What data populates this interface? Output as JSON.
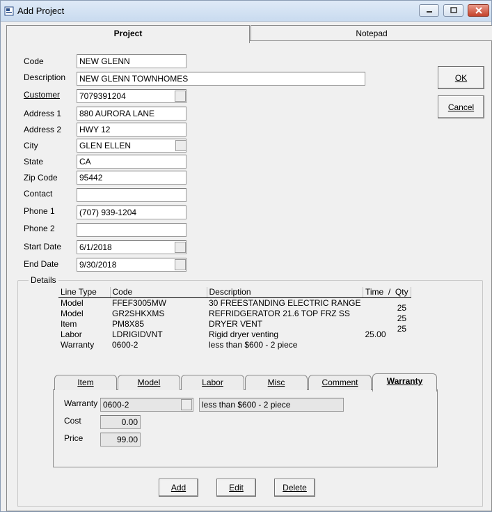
{
  "window": {
    "title": "Add Project"
  },
  "main_tabs": [
    {
      "label": "Project"
    },
    {
      "label": "Notepad"
    }
  ],
  "form": {
    "code": {
      "label": "Code",
      "value": "NEW GLENN"
    },
    "description": {
      "label": "Description",
      "value": "NEW GLENN TOWNHOMES"
    },
    "customer": {
      "label": "Customer",
      "value": "7079391204"
    },
    "address1": {
      "label": "Address 1",
      "value": "880 AURORA LANE"
    },
    "address2": {
      "label": "Address 2",
      "value": "HWY 12"
    },
    "city": {
      "label": "City",
      "value": "GLEN ELLEN"
    },
    "state": {
      "label": "State",
      "value": "CA"
    },
    "zip": {
      "label": "Zip Code",
      "value": "95442"
    },
    "contact": {
      "label": "Contact",
      "value": ""
    },
    "phone1": {
      "label": "Phone 1",
      "value": "(707) 939-1204"
    },
    "phone2": {
      "label": "Phone 2",
      "value": ""
    },
    "start_date": {
      "label": "Start Date",
      "value": "6/1/2018"
    },
    "end_date": {
      "label": "End Date",
      "value": "9/30/2018"
    }
  },
  "actions": {
    "ok": "OK",
    "cancel": "Cancel"
  },
  "details": {
    "title": "Details",
    "columns": [
      "Line Type",
      "Code",
      "Description",
      "Time",
      "/",
      "Qty"
    ],
    "rows": [
      {
        "type": "Model",
        "code": "FFEF3005MW",
        "description": "30 FREESTANDING ELECTRIC RANGE",
        "time": "",
        "qty": "25"
      },
      {
        "type": "Model",
        "code": "GR2SHKXMS",
        "description": "REFRIDGERATOR 21.6 TOP FRZ SS",
        "time": "",
        "qty": "25"
      },
      {
        "type": "Item",
        "code": "PM8X85",
        "description": "DRYER VENT",
        "time": "",
        "qty": "25"
      },
      {
        "type": "Labor",
        "code": "LDRIGIDVNT",
        "description": "Rigid dryer venting",
        "time": "25.00",
        "qty": ""
      },
      {
        "type": "Warranty",
        "code": "0600-2",
        "description": "less than $600 - 2 piece",
        "time": "",
        "qty": ""
      }
    ]
  },
  "sub_tabs": [
    {
      "label": "Item"
    },
    {
      "label": "Model"
    },
    {
      "label": "Labor"
    },
    {
      "label": "Misc"
    },
    {
      "label": "Comment"
    },
    {
      "label": "Warranty"
    }
  ],
  "warranty": {
    "warranty_label": "Warranty",
    "warranty_code": "0600-2",
    "warranty_desc": "less than $600 - 2 piece",
    "cost_label": "Cost",
    "cost": "0.00",
    "price_label": "Price",
    "price": "99.00"
  },
  "line_actions": {
    "add": "Add",
    "edit": "Edit",
    "delete": "Delete"
  }
}
